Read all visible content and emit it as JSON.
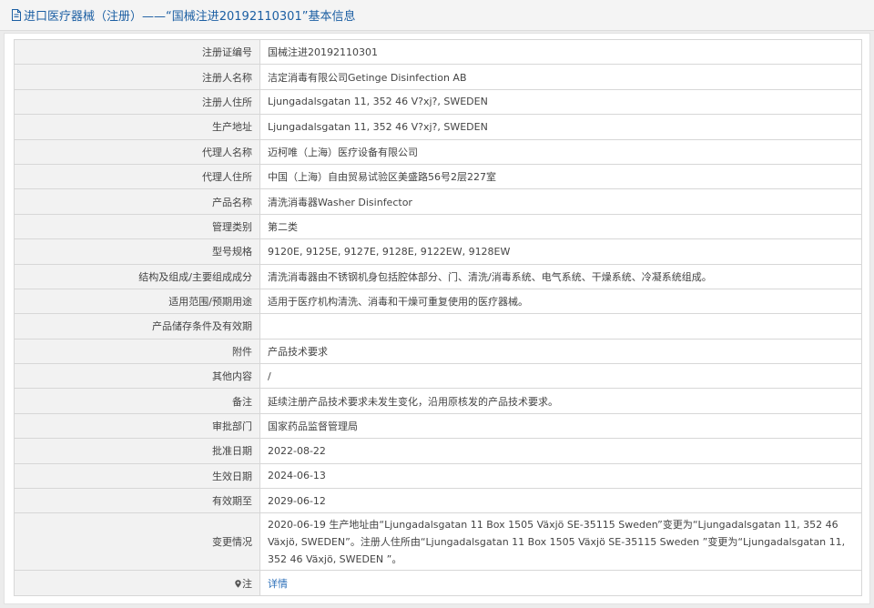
{
  "header": {
    "title": "进口医疗器械（注册）——“国械注进20192110301”基本信息"
  },
  "rows": [
    {
      "label": "注册证编号",
      "value": "国械注进20192110301"
    },
    {
      "label": "注册人名称",
      "value": "洁定消毒有限公司Getinge Disinfection AB"
    },
    {
      "label": "注册人住所",
      "value": "Ljungadalsgatan 11, 352 46 V?xj?, SWEDEN"
    },
    {
      "label": "生产地址",
      "value": "Ljungadalsgatan 11, 352 46 V?xj?, SWEDEN"
    },
    {
      "label": "代理人名称",
      "value": "迈柯唯（上海）医疗设备有限公司"
    },
    {
      "label": "代理人住所",
      "value": "中国（上海）自由贸易试验区美盛路56号2层227室"
    },
    {
      "label": "产品名称",
      "value": "清洗消毒器Washer Disinfector"
    },
    {
      "label": "管理类别",
      "value": "第二类"
    },
    {
      "label": "型号规格",
      "value": "9120E, 9125E, 9127E, 9128E, 9122EW, 9128EW"
    },
    {
      "label": "结构及组成/主要组成成分",
      "value": "清洗消毒器由不锈钢机身包括腔体部分、门、清洗/消毒系统、电气系统、干燥系统、冷凝系统组成。"
    },
    {
      "label": "适用范围/预期用途",
      "value": "适用于医疗机构清洗、消毒和干燥可重复使用的医疗器械。"
    },
    {
      "label": "产品储存条件及有效期",
      "value": ""
    },
    {
      "label": "附件",
      "value": "产品技术要求"
    },
    {
      "label": "其他内容",
      "value": "/"
    },
    {
      "label": "备注",
      "value": "延续注册产品技术要求未发生变化，沿用原核发的产品技术要求。"
    },
    {
      "label": "审批部门",
      "value": "国家药品监督管理局"
    },
    {
      "label": "批准日期",
      "value": "2022-08-22"
    },
    {
      "label": "生效日期",
      "value": "2024-06-13"
    },
    {
      "label": "有效期至",
      "value": "2029-06-12"
    }
  ],
  "change": {
    "label": "变更情况",
    "value": "2020-06-19 生产地址由“Ljungadalsgatan 11 Box 1505 Växjö SE-35115 Sweden”变更为“Ljungadalsgatan 11, 352 46 Växjö, SWEDEN”。注册人住所由“Ljungadalsgatan 11 Box 1505 Växjö SE-35115 Sweden ”变更为“Ljungadalsgatan 11, 352 46 Växjö, SWEDEN ”。"
  },
  "note": {
    "label": "注",
    "icon": "map-pin-icon",
    "link_text": "详情"
  },
  "colors": {
    "header_text": "#1c5fa3",
    "link": "#2a6eb8",
    "label_bg": "#f2f2f2",
    "border": "#d7d7d7"
  }
}
